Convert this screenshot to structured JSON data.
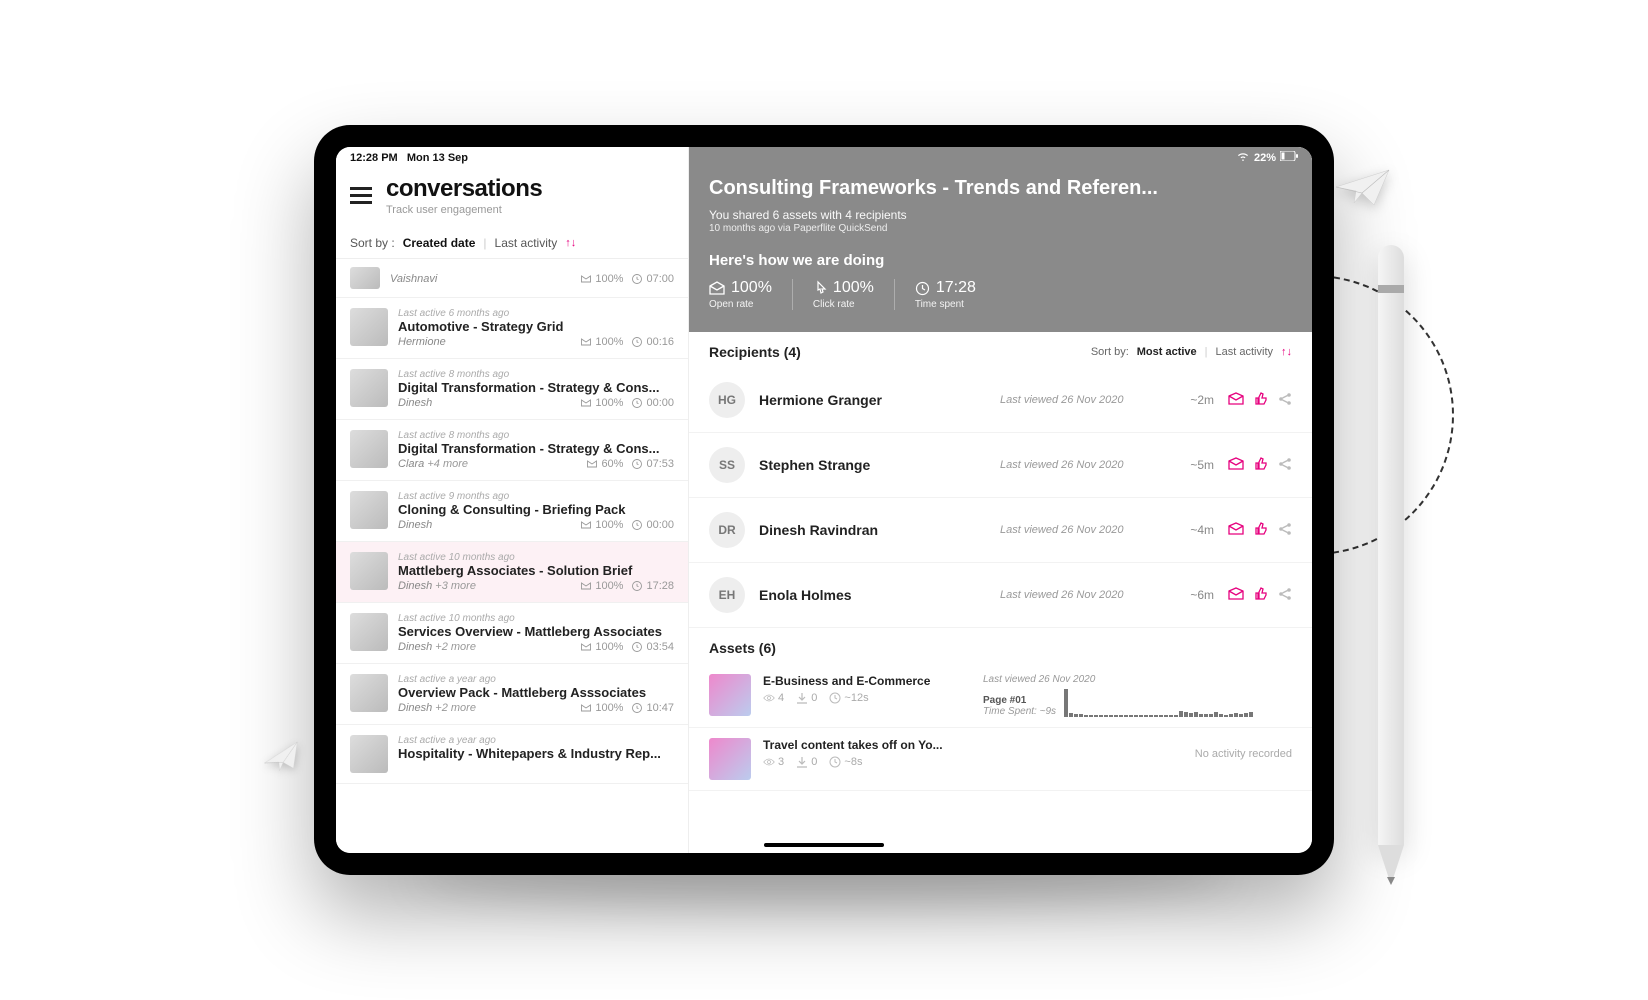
{
  "status": {
    "time": "12:28 PM",
    "date": "Mon 13 Sep",
    "battery": "22%"
  },
  "header": {
    "title": "conversations",
    "subtitle": "Track user engagement"
  },
  "sort": {
    "label": "Sort by :",
    "created": "Created date",
    "last": "Last activity"
  },
  "topitem": {
    "author": "Vaishnavi",
    "open": "100%",
    "time": "07:00"
  },
  "conversations": [
    {
      "age": "Last active 6 months ago",
      "title": "Automotive - Strategy Grid",
      "author": "Hermione",
      "extra": "",
      "open": "100%",
      "time": "00:16"
    },
    {
      "age": "Last active 8 months ago",
      "title": "Digital Transformation - Strategy & Cons...",
      "author": "Dinesh",
      "extra": "",
      "open": "100%",
      "time": "00:00"
    },
    {
      "age": "Last active 8 months ago",
      "title": "Digital Transformation - Strategy & Cons...",
      "author": "Clara",
      "extra": "+4 more",
      "open": "60%",
      "time": "07:53"
    },
    {
      "age": "Last active 9 months ago",
      "title": "Cloning & Consulting - Briefing Pack",
      "author": "Dinesh",
      "extra": "",
      "open": "100%",
      "time": "00:00"
    },
    {
      "age": "Last active 10 months ago",
      "title": "Mattleberg Associates - Solution Brief",
      "author": "Dinesh",
      "extra": "+3 more",
      "open": "100%",
      "time": "17:28",
      "selected": true
    },
    {
      "age": "Last active 10 months ago",
      "title": "Services Overview - Mattleberg Associates",
      "author": "Dinesh",
      "extra": "+2 more",
      "open": "100%",
      "time": "03:54"
    },
    {
      "age": "Last active a year ago",
      "title": "Overview Pack - Mattleberg Asssociates",
      "author": "Dinesh",
      "extra": "+2 more",
      "open": "100%",
      "time": "10:47"
    },
    {
      "age": "Last active a year ago",
      "title": "Hospitality - Whitepapers & Industry Rep...",
      "author": "",
      "extra": "",
      "open": "",
      "time": ""
    }
  ],
  "detail": {
    "title": "Consulting Frameworks - Trends and Referen...",
    "shared": "You shared 6 assets with 4 recipients",
    "when": "10 months ago via Paperflite QuickSend",
    "doing": "Here's how we are doing",
    "stats": {
      "open": "100%",
      "open_lbl": "Open rate",
      "click": "100%",
      "click_lbl": "Click rate",
      "time": "17:28",
      "time_lbl": "Time spent"
    }
  },
  "recipients": {
    "title": "Recipients (4)",
    "sort_label": "Sort by:",
    "sort_most": "Most active",
    "sort_last": "Last activity",
    "items": [
      {
        "initials": "HG",
        "name": "Hermione Granger",
        "viewed": "Last viewed 26 Nov 2020",
        "time": "~2m"
      },
      {
        "initials": "SS",
        "name": "Stephen  Strange",
        "viewed": "Last viewed 26 Nov 2020",
        "time": "~5m"
      },
      {
        "initials": "DR",
        "name": "Dinesh Ravindran",
        "viewed": "Last viewed 26 Nov 2020",
        "time": "~4m"
      },
      {
        "initials": "EH",
        "name": "Enola Holmes",
        "viewed": "Last viewed 26 Nov 2020",
        "time": "~6m"
      }
    ]
  },
  "assets": {
    "title": "Assets (6)",
    "items": [
      {
        "title": "E-Business and E-Commerce",
        "views": "4",
        "downloads": "0",
        "time": "~12s",
        "viewed": "Last viewed 26 Nov 2020",
        "page": "Page #01",
        "spent": "Time Spent: ~9s",
        "activity": true
      },
      {
        "title": "Travel content takes off on Yo...",
        "views": "3",
        "downloads": "0",
        "time": "~8s",
        "none": "No activity recorded",
        "activity": false
      }
    ]
  }
}
